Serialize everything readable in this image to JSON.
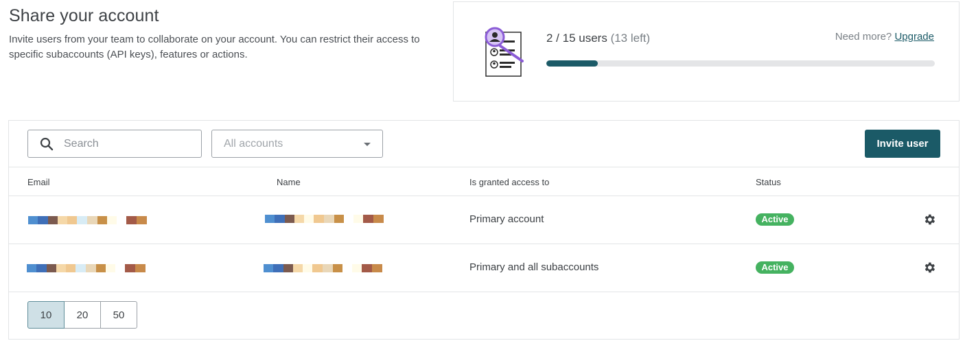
{
  "header": {
    "title": "Share your account",
    "description": "Invite users from your team to collaborate on your account. You can restrict their access to specific subaccounts (API keys), features or actions."
  },
  "usage": {
    "count_text": "2 / 15 users",
    "left_text": "(13 left)",
    "need_more_text": "Need more?",
    "upgrade_label": "Upgrade",
    "progress_fraction": 0.133,
    "illustration_icon": "user-list-magnifier-icon",
    "accent_color": "#1b5a67",
    "illustration_color": "#8b5cd6"
  },
  "toolbar": {
    "search_placeholder": "Search",
    "accounts_select_value": "All accounts",
    "invite_label": "Invite user"
  },
  "table": {
    "columns": [
      "Email",
      "Name",
      "Is granted access to",
      "Status"
    ],
    "rows": [
      {
        "email": "[redacted]",
        "name": "[redacted]",
        "access": "Primary account",
        "status": "Active"
      },
      {
        "email": "[redacted]",
        "name": "[redacted]",
        "access": "Primary and all subaccounts",
        "status": "Active"
      }
    ],
    "status_color": "#45b260"
  },
  "pagination": {
    "sizes": [
      "10",
      "20",
      "50"
    ],
    "selected": "10"
  }
}
